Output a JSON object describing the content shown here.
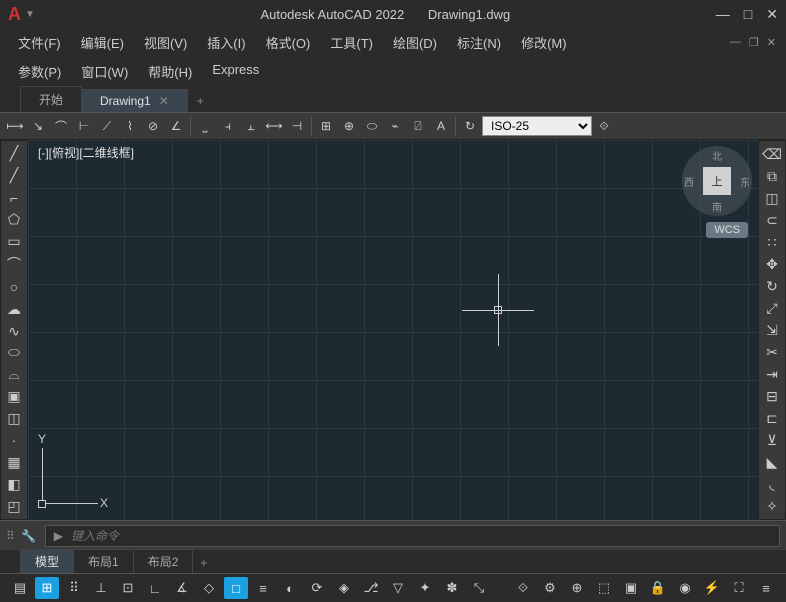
{
  "title": {
    "app": "Autodesk AutoCAD 2022",
    "file": "Drawing1.dwg"
  },
  "menus": {
    "row1": [
      {
        "label": "文件(F)"
      },
      {
        "label": "编辑(E)"
      },
      {
        "label": "视图(V)"
      },
      {
        "label": "插入(I)"
      },
      {
        "label": "格式(O)"
      },
      {
        "label": "工具(T)"
      },
      {
        "label": "绘图(D)"
      },
      {
        "label": "标注(N)"
      },
      {
        "label": "修改(M)"
      }
    ],
    "row2": [
      {
        "label": "参数(P)"
      },
      {
        "label": "窗口(W)"
      },
      {
        "label": "帮助(H)"
      },
      {
        "label": "Express"
      }
    ]
  },
  "tabs": {
    "start": "开始",
    "doc1": "Drawing1"
  },
  "ribbon": {
    "dimstyle": "ISO-25"
  },
  "viewport": {
    "label": "[-][俯视][二维线框]"
  },
  "navcube": {
    "face": "上",
    "n": "北",
    "s": "南",
    "e": "东",
    "w": "西",
    "wcs": "WCS"
  },
  "ucs": {
    "x": "X",
    "y": "Y"
  },
  "command": {
    "prompt": "▶",
    "placeholder": "键入命令"
  },
  "btabs": {
    "model": "模型",
    "layout1": "布局1",
    "layout2": "布局2"
  }
}
